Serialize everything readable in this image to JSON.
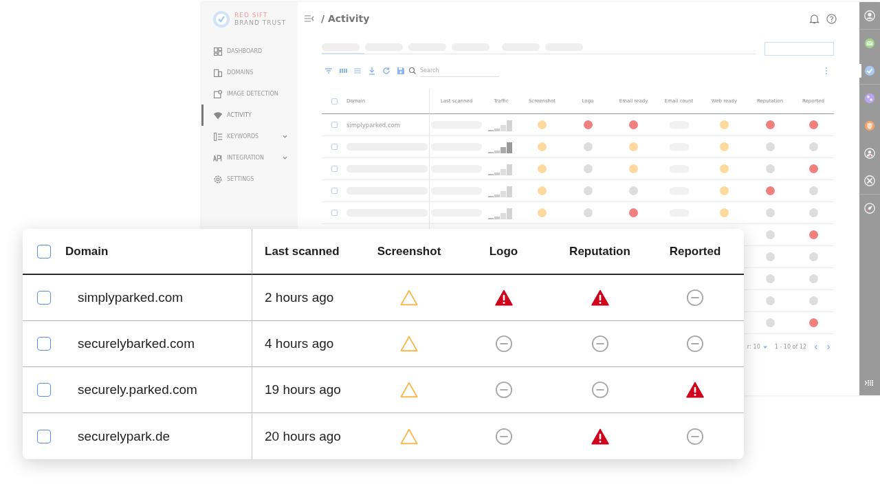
{
  "app": {
    "brand": {
      "line1": "RED SIFT",
      "line2": "BRAND TRUST"
    },
    "sidebar": {
      "items": [
        {
          "label": "DASHBOARD",
          "selected": false,
          "has_submenu": false
        },
        {
          "label": "DOMAINS",
          "selected": false,
          "has_submenu": false
        },
        {
          "label": "IMAGE DETECTION",
          "selected": false,
          "has_submenu": false
        },
        {
          "label": "ACTIVITY",
          "selected": true,
          "has_submenu": false
        },
        {
          "label": "KEYWORDS",
          "selected": false,
          "has_submenu": true
        },
        {
          "label": "INTEGRATION",
          "selected": false,
          "has_submenu": true
        },
        {
          "label": "SETTINGS",
          "selected": false,
          "has_submenu": false
        }
      ]
    },
    "title": "/ Activity",
    "search": {
      "placeholder": "Search"
    },
    "table": {
      "header_checked": false,
      "columns": [
        "Domain",
        "Last scanned",
        "Traffic",
        "Screenshot",
        "Logo",
        "Email ready",
        "Email count",
        "Web ready",
        "Reputation",
        "Reported"
      ],
      "rows": [
        {
          "kind": "full",
          "checked": false,
          "domain": "simplyparked.com",
          "screenshot": {
            "color": "#fdd9a0"
          },
          "logo": {
            "color": "#ee8080"
          },
          "email_ready": {
            "color": "#ee8080"
          },
          "web_ready": {
            "color": "#fdd9a0"
          },
          "reputation": {
            "color": "#ee8080"
          },
          "reported": {
            "color": "#ee8080"
          }
        },
        {
          "kind": "full",
          "checked": false,
          "screenshot": {
            "color": "#fdd9a0"
          },
          "logo": {
            "color": "#dddddd"
          },
          "email_ready": {
            "color": "#fdd9a0"
          },
          "web_ready": {
            "color": "#fdd9a0"
          },
          "reputation": {
            "color": "#dddddd"
          },
          "reported": {
            "color": "#dddddd"
          }
        },
        {
          "kind": "full",
          "checked": false,
          "screenshot": {
            "color": "#fdd9a0"
          },
          "logo": {
            "color": "#dddddd"
          },
          "email_ready": {
            "color": "#fdd9a0"
          },
          "web_ready": {
            "color": "#fdd9a0"
          },
          "reputation": {
            "color": "#dddddd"
          },
          "reported": {
            "color": "#ee8080"
          }
        },
        {
          "kind": "full",
          "checked": false,
          "screenshot": {
            "color": "#fdd9a0"
          },
          "logo": {
            "color": "#dddddd"
          },
          "email_ready": {
            "color": "#dddddd"
          },
          "web_ready": {
            "color": "#fdd9a0"
          },
          "reputation": {
            "color": "#ee8080"
          },
          "reported": {
            "color": "#dddddd"
          }
        },
        {
          "kind": "full",
          "checked": false,
          "screenshot": {
            "color": "#fdd9a0"
          },
          "logo": {
            "color": "#dddddd"
          },
          "email_ready": {
            "color": "#ee8080"
          },
          "web_ready": {
            "color": "#fdd9a0"
          },
          "reputation": {
            "color": "#dddddd"
          },
          "reported": {
            "color": "#dddddd"
          }
        },
        {
          "kind": "partial",
          "reputation": {
            "color": "#dddddd"
          },
          "reported": {
            "color": "#ee8080"
          }
        },
        {
          "kind": "partial",
          "reputation": {
            "color": "#dddddd"
          },
          "reported": {
            "color": "#dddddd"
          }
        },
        {
          "kind": "partial",
          "reputation": {
            "color": "#dddddd"
          },
          "reported": {
            "color": "#dddddd"
          }
        },
        {
          "kind": "partial",
          "reputation": {
            "color": "#dddddd"
          },
          "reported": {
            "color": "#dddddd"
          }
        },
        {
          "kind": "partial",
          "reputation": {
            "color": "#dddddd"
          },
          "reported": {
            "color": "#ee8080"
          }
        }
      ]
    },
    "pagination": {
      "rows_label": "r:",
      "page_size": "10",
      "range": "1 - 10 of 12"
    },
    "rail": {
      "items": [
        {
          "selected": false
        },
        {
          "selected": false
        },
        {
          "selected": true
        },
        {
          "selected": false
        },
        {
          "selected": false
        },
        {
          "selected": false
        },
        {
          "selected": false
        },
        {
          "selected": false
        }
      ]
    }
  },
  "card": {
    "header_checked": false,
    "columns": [
      "Domain",
      "Last scanned",
      "Screenshot",
      "Logo",
      "Reputation",
      "Reported"
    ],
    "rows": [
      {
        "checked": false,
        "domain": "simplyparked.com",
        "last_scanned": "2 hours ago",
        "screenshot": {
          "kind": "warning"
        },
        "logo": {
          "kind": "alert"
        },
        "reputation": {
          "kind": "alert"
        },
        "reported": {
          "kind": "none"
        }
      },
      {
        "checked": false,
        "domain": "securelybarked.com",
        "last_scanned": "4 hours ago",
        "screenshot": {
          "kind": "warning"
        },
        "logo": {
          "kind": "none"
        },
        "reputation": {
          "kind": "none"
        },
        "reported": {
          "kind": "none"
        }
      },
      {
        "checked": false,
        "domain": "securely.parked.com",
        "last_scanned": "19 hours ago",
        "screenshot": {
          "kind": "warning"
        },
        "logo": {
          "kind": "none"
        },
        "reputation": {
          "kind": "none"
        },
        "reported": {
          "kind": "alert"
        }
      },
      {
        "checked": false,
        "domain": "securelypark.de",
        "last_scanned": "20 hours ago",
        "screenshot": {
          "kind": "warning"
        },
        "logo": {
          "kind": "none"
        },
        "reputation": {
          "kind": "alert"
        },
        "reported": {
          "kind": "none"
        }
      }
    ]
  }
}
